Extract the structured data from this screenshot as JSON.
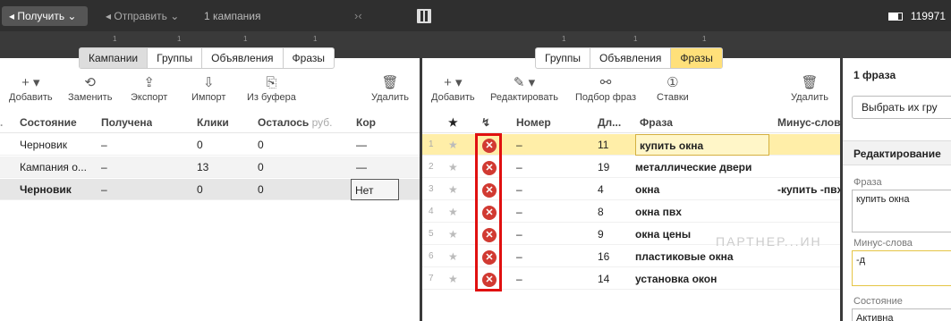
{
  "toolbar": {
    "get_label": "◂ Получить ⌄",
    "send_label": "◂ Отправить ⌄",
    "campaign_count": "1 кампания",
    "collapse_glyph": "›‹",
    "user_id": "119971"
  },
  "left_tabs": [
    "Кампании",
    "Группы",
    "Объявления",
    "Фразы"
  ],
  "left_actions": [
    {
      "icon": "+ ▾",
      "label": "Добавить"
    },
    {
      "icon": "⟲",
      "label": "Заменить"
    },
    {
      "icon": "⇪",
      "label": "Экспорт"
    },
    {
      "icon": "⇩",
      "label": "Импорт"
    },
    {
      "icon": "⎘",
      "label": "Из буфера"
    },
    {
      "icon": "🗑",
      "label": "Удалить"
    }
  ],
  "campaigns": {
    "headers": {
      "status": "Состояние",
      "received": "Получена",
      "clicks": "Клики",
      "left": "Осталось",
      "left_unit": "руб.",
      "kor": "Кор"
    },
    "rows": [
      {
        "status": "Черновик",
        "received": "–",
        "clicks": "0",
        "left": "0",
        "kor": "—"
      },
      {
        "status": "Кампания о...",
        "received": "–",
        "clicks": "13",
        "left": "0",
        "kor": "—"
      },
      {
        "status": "Черновик",
        "received": "–",
        "clicks": "0",
        "left": "0",
        "kor": "Нет"
      }
    ]
  },
  "mid_tabs": [
    "Группы",
    "Объявления",
    "Фразы"
  ],
  "mid_actions": [
    {
      "icon": "+ ▾",
      "label": "Добавить"
    },
    {
      "icon": "✎ ▾",
      "label": "Редактировать"
    },
    {
      "icon": "⚯",
      "label": "Подбор фраз"
    },
    {
      "icon": "①",
      "label": "Ставки"
    },
    {
      "icon": "🗑",
      "label": "Удалить"
    }
  ],
  "phrases": {
    "headers": {
      "star": "★",
      "flag": "↯",
      "number": "Номер",
      "length": "Дл...",
      "phrase": "Фраза",
      "minus": "Минус-слов"
    },
    "rows": [
      {
        "n": "1",
        "number": "–",
        "length": "11",
        "phrase": "купить окна",
        "minus": ""
      },
      {
        "n": "2",
        "number": "–",
        "length": "19",
        "phrase": "металлические двери",
        "minus": ""
      },
      {
        "n": "3",
        "number": "–",
        "length": "4",
        "phrase": "окна",
        "minus": "-купить -пвх"
      },
      {
        "n": "4",
        "number": "–",
        "length": "8",
        "phrase": "окна пвх",
        "minus": ""
      },
      {
        "n": "5",
        "number": "–",
        "length": "9",
        "phrase": "окна цены",
        "minus": ""
      },
      {
        "n": "6",
        "number": "–",
        "length": "16",
        "phrase": "пластиковые окна",
        "minus": ""
      },
      {
        "n": "7",
        "number": "–",
        "length": "14",
        "phrase": "установка окон",
        "minus": ""
      }
    ]
  },
  "right_panel": {
    "title": "1 фраза",
    "choose_button": "Выбрать их гру",
    "section": "Редактирование",
    "phrase_label": "Фраза",
    "phrase_value": "купить окна",
    "minus_label": "Минус-слова",
    "minus_value": "-д",
    "state_label": "Состояние",
    "state_value": "Активна"
  },
  "watermark": "ПАРТНЕР...ИН",
  "colors": {
    "accent_yellow": "#ffe07a",
    "highlight_row": "#ffeea8",
    "error_red": "#d13a32",
    "frame_red": "#e01010"
  }
}
